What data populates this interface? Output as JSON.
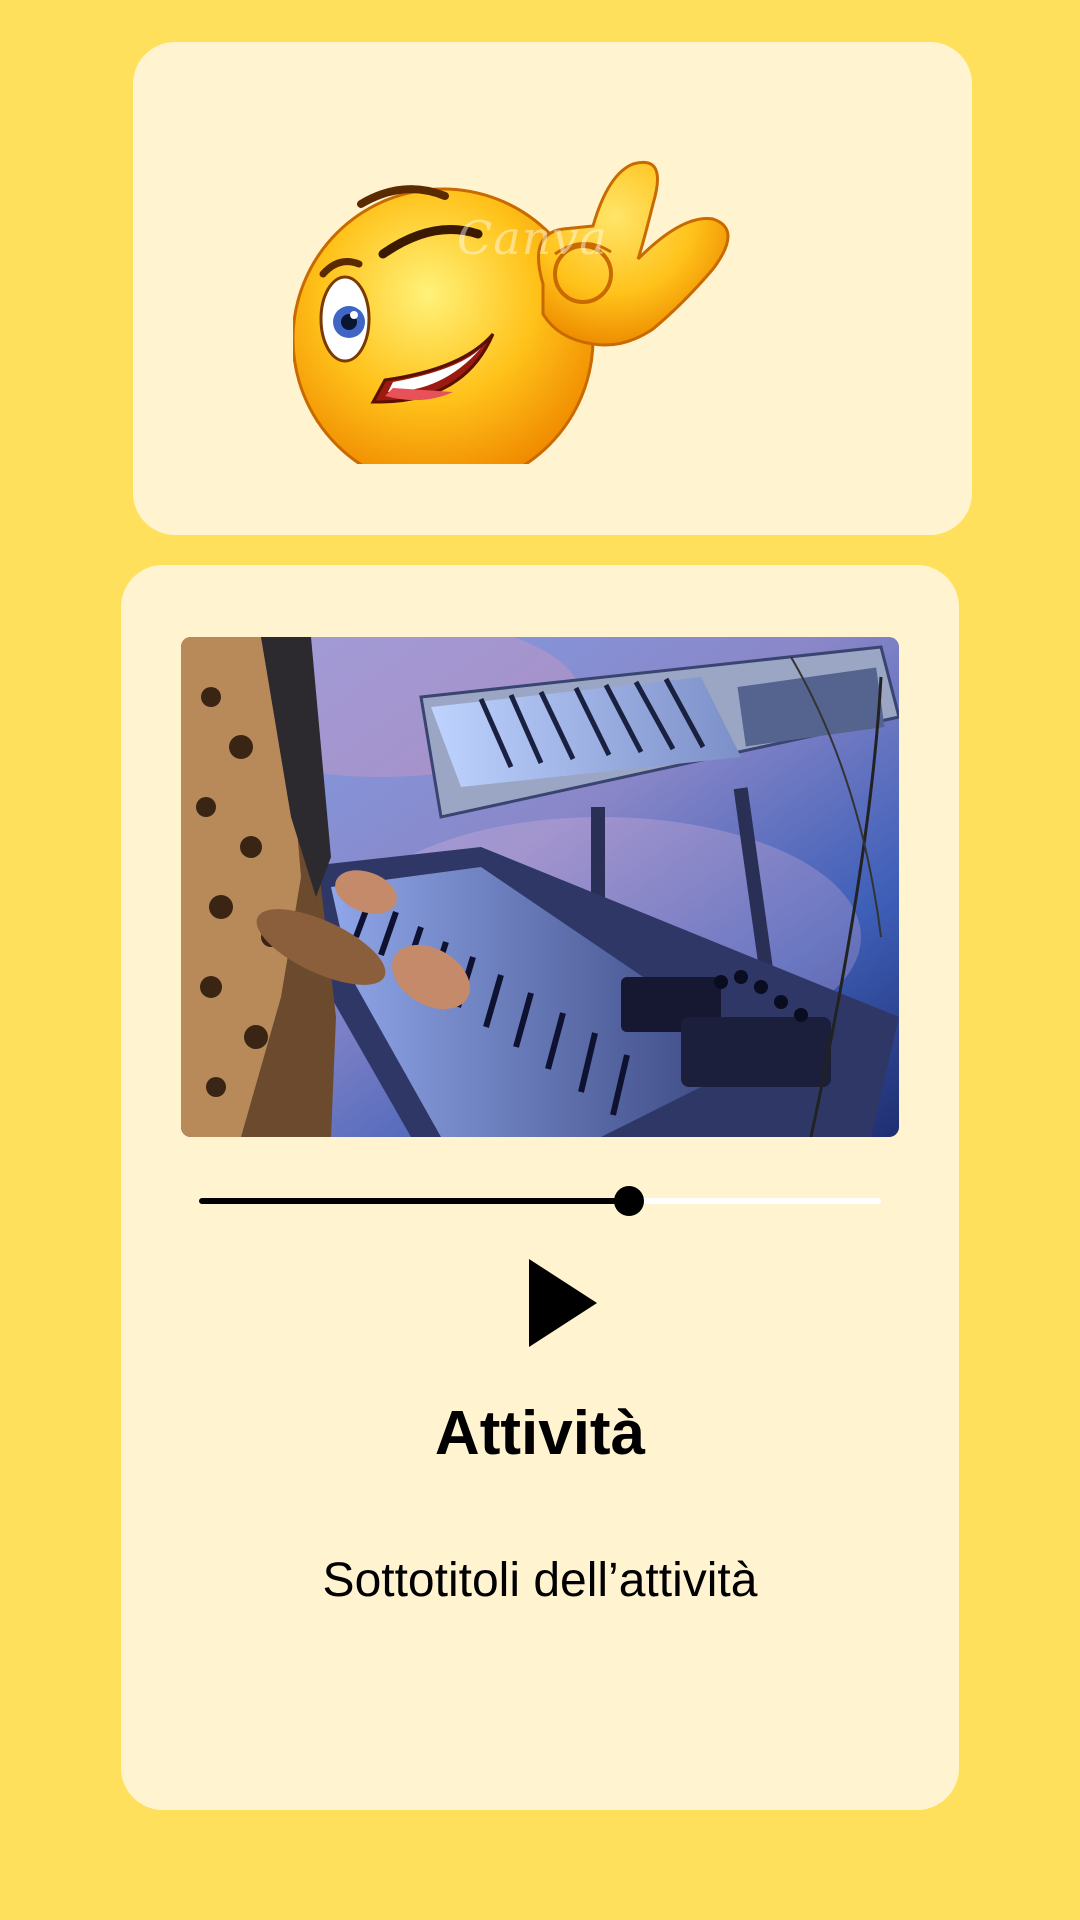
{
  "emoji_card": {
    "icon": "winking-ok-hand-emoji-icon",
    "watermark": "Canva"
  },
  "player": {
    "image_icon": "keyboard-player-photo",
    "progress": 0.63,
    "play_icon": "play-icon",
    "title": "Attività",
    "subtitle": "Sottotitoli dell’attività"
  },
  "colors": {
    "background": "#FFE05C",
    "card": "#FFF4CF",
    "progress_played": "#000000",
    "progress_remaining": "#FFFFFF"
  }
}
